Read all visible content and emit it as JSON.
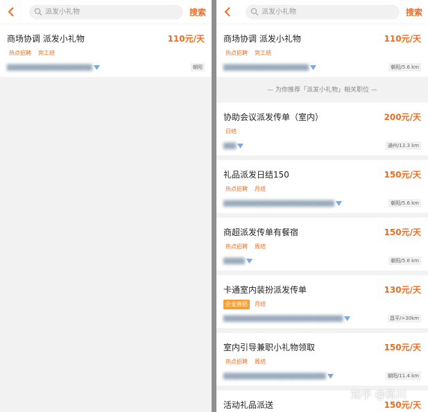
{
  "search": {
    "query": "派发小礼物",
    "submit_label": "搜索"
  },
  "left_results": [
    {
      "title": "商场协调 派发小礼物",
      "pay": "110元/天",
      "tags": [
        "热点招聘",
        "完工结"
      ],
      "location": "朝阳"
    }
  ],
  "right_results": [
    {
      "title": "商场协调 派发小礼物",
      "pay": "110元/天",
      "tags": [
        "热点招聘",
        "完工结"
      ],
      "location": "朝阳/5.6 km"
    }
  ],
  "recommend_divider": "— 为你推荐「派发小礼物」相关职位 —",
  "recommended": [
    {
      "title": "协助会议派发传单（室内）",
      "pay": "200元/天",
      "tags": [
        "日结"
      ],
      "location": "通州/13.3 km"
    },
    {
      "title": "礼品派发日结150",
      "pay": "150元/天",
      "tags": [
        "热点招聘",
        "月结"
      ],
      "location": "朝阳/5.6 km"
    },
    {
      "title": "商超派发传单有餐宿",
      "pay": "150元/天",
      "tags": [
        "热点招聘",
        "周结"
      ],
      "location": "朝阳/5.6 km"
    },
    {
      "title": "卡通室内装扮派发传单",
      "pay": "130元/天",
      "tags": [
        "企业直招",
        "月结"
      ],
      "location": "昌平/>30km"
    },
    {
      "title": "室内引导兼职小礼物领取",
      "pay": "150元/天",
      "tags": [
        "热点招聘",
        "周结"
      ],
      "location": "朝阳/11.4 km"
    },
    {
      "title": "活动礼品派送",
      "pay": "150元/天",
      "tags": [],
      "location": ""
    }
  ],
  "watermark": "知乎 @蒋川",
  "colors": {
    "accent": "#f26b1d",
    "highlight_tag": "#f6a033"
  }
}
